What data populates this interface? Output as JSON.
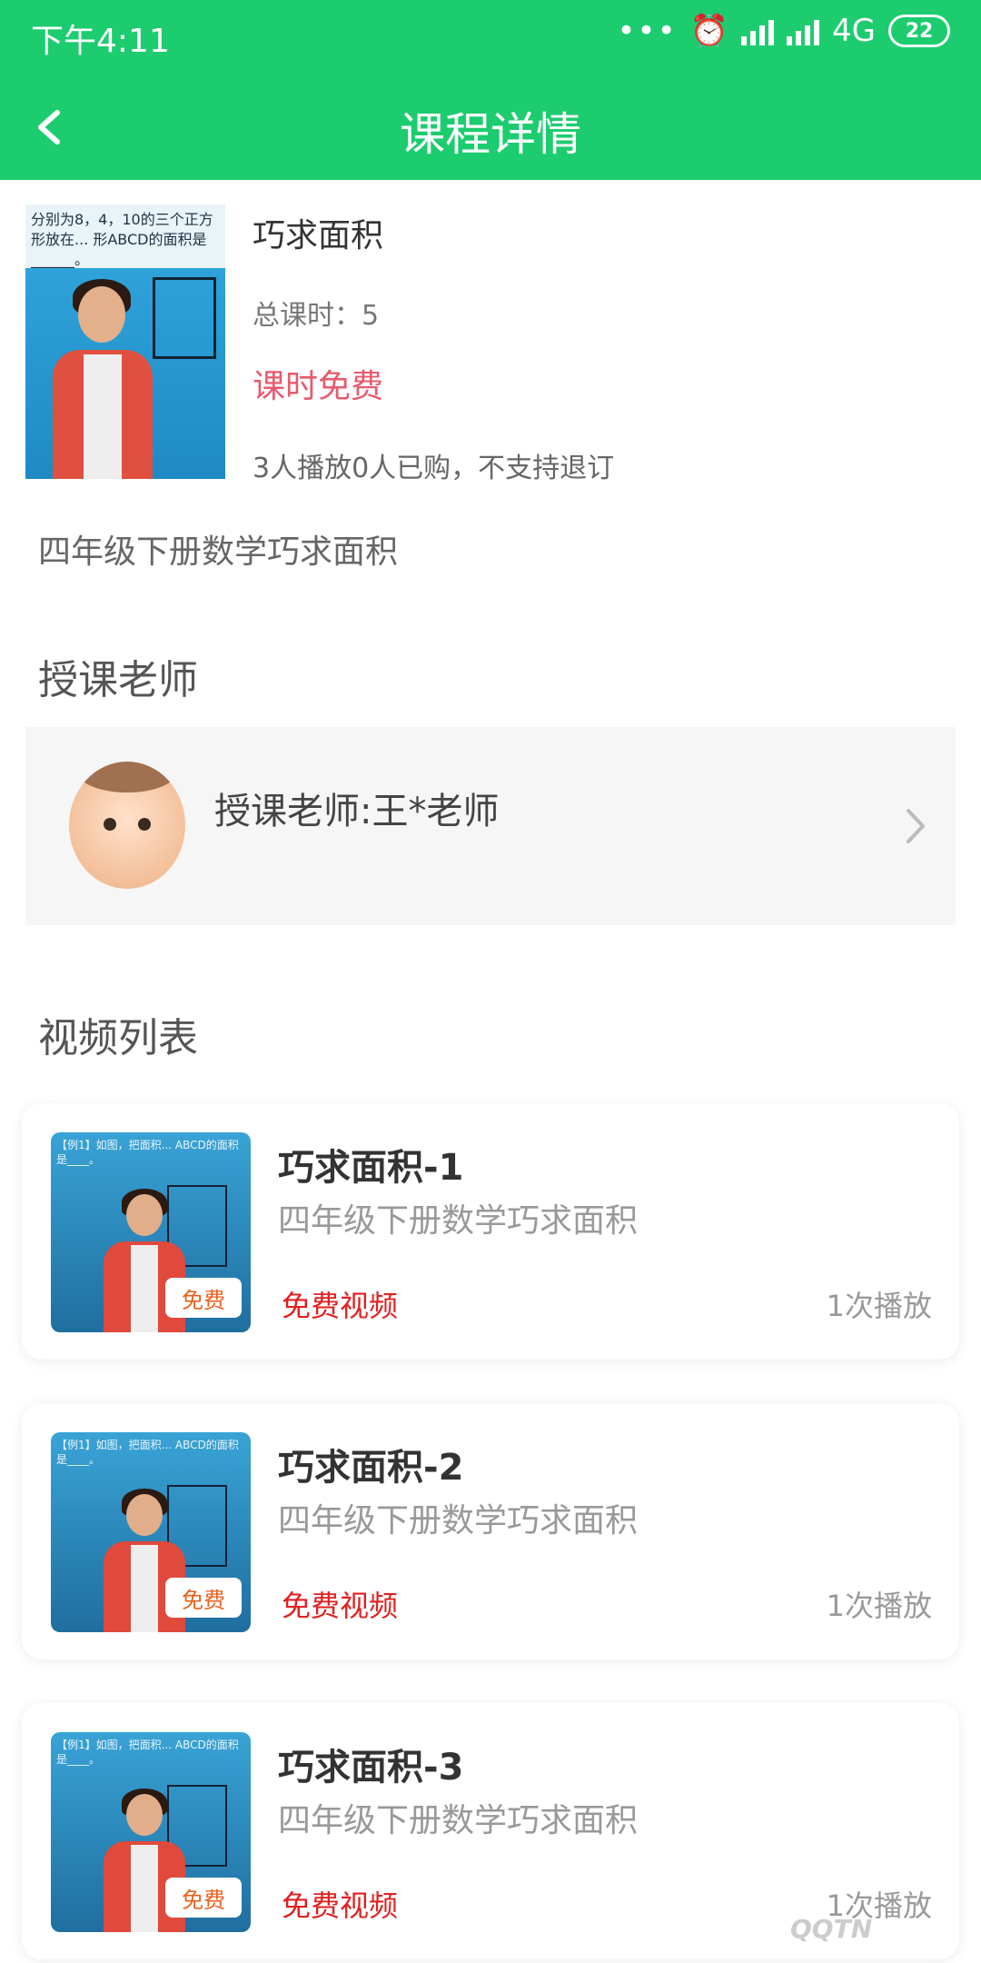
{
  "status": {
    "time": "下午4:11",
    "network": "4G",
    "battery": "22"
  },
  "header": {
    "title": "课程详情"
  },
  "course": {
    "title": "巧求面积",
    "total_hours": "总课时：5",
    "price": "课时免费",
    "stats": "3人播放0人已购，不支持退订",
    "description": "四年级下册数学巧求面积",
    "thumb_text": "分别为8，4，10的三个正方形放在... 形ABCD的面积是______。"
  },
  "teacher_section": {
    "title": "授课老师",
    "teacher_name": "授课老师:王*老师"
  },
  "video_section": {
    "title": "视频列表",
    "videos": [
      {
        "title": "巧求面积-1",
        "desc": "四年级下册数学巧求面积",
        "tag": "免费视频",
        "plays": "1次播放",
        "badge": "免费"
      },
      {
        "title": "巧求面积-2",
        "desc": "四年级下册数学巧求面积",
        "tag": "免费视频",
        "plays": "1次播放",
        "badge": "免费"
      },
      {
        "title": "巧求面积-3",
        "desc": "四年级下册数学巧求面积",
        "tag": "免费视频",
        "plays": "1次播放",
        "badge": "免费"
      }
    ]
  },
  "watermark": {
    "text": "QQTN"
  },
  "colors": {
    "brand_green": "#1dcc6f",
    "price_pink": "#e85a6e",
    "tag_red": "#e02020",
    "badge_orange": "#e8601c"
  }
}
